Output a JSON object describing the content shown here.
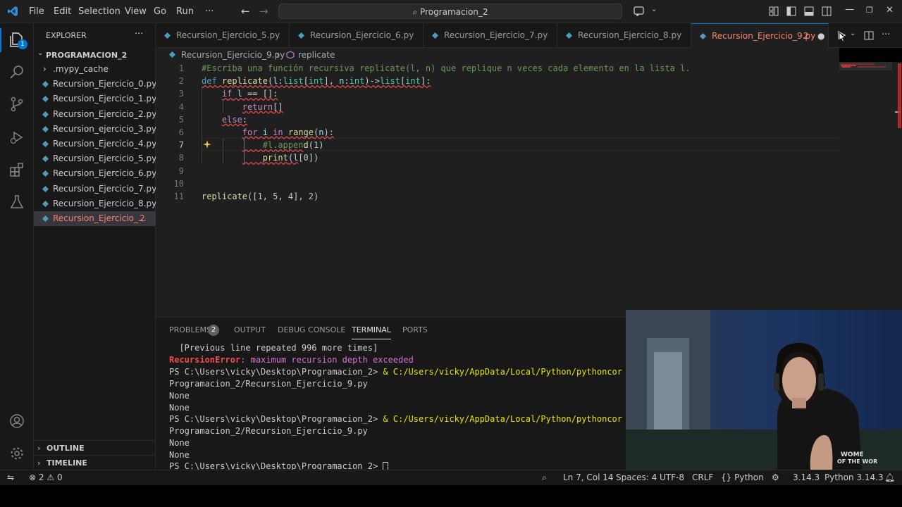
{
  "titlebar": {
    "menus": [
      "File",
      "Edit",
      "Selection",
      "View",
      "Go",
      "Run",
      "···"
    ],
    "search": "Programacion_2"
  },
  "activitybar": {
    "explorer_badge": "1"
  },
  "sidebar": {
    "title": "EXPLORER",
    "more": "···",
    "folder": "PROGRAMACION_2",
    "items": [
      {
        "label": ".mypy_cache",
        "type": "folder"
      },
      {
        "label": "Recursion_Ejercicio_0.py",
        "type": "py"
      },
      {
        "label": "Recursion_Ejercicio_1.py",
        "type": "py"
      },
      {
        "label": "Recursion_Ejercicio_2.py",
        "type": "py"
      },
      {
        "label": "Recursion_ejercicio_3.py",
        "type": "py"
      },
      {
        "label": "Recursion_Ejercicio_4.py",
        "type": "py"
      },
      {
        "label": "Recursion_Ejercicio_5.py",
        "type": "py"
      },
      {
        "label": "Recursion_Ejercicio_6.py",
        "type": "py"
      },
      {
        "label": "Recursion_Ejercicio_7.py",
        "type": "py"
      },
      {
        "label": "Recursion_Ejercicio_8.py",
        "type": "py"
      },
      {
        "label": "Recursion_Ejercicio_...",
        "type": "py",
        "badge": "2",
        "active": true
      }
    ],
    "outline": "OUTLINE",
    "timeline": "TIMELINE"
  },
  "tabs": [
    {
      "label": "Recursion_Ejercicio_5.py"
    },
    {
      "label": "Recursion_Ejercicio_6.py"
    },
    {
      "label": "Recursion_Ejercicio_7.py"
    },
    {
      "label": "Recursion_Ejercicio_8.py"
    },
    {
      "label": "Recursion_Ejercicio_9.py",
      "badge": "2",
      "dirty": "●",
      "active": true
    }
  ],
  "breadcrumb": {
    "file": "Recursion_Ejercicio_9.py",
    "separator": "›",
    "symbol": "replicate"
  },
  "editor": {
    "current_line": 7,
    "lines": [
      "#Escriba una función recursiva replicate(l, n) que replique n veces cada elemento en la lista l.",
      "def replicate(l:list[int], n:int)->list[int]:",
      "    if l == []:",
      "        return[]",
      "    else:",
      "        for i in range(n):",
      "            #l.append(1)",
      "            print(l[0])",
      "",
      "",
      "replicate([1, 5, 4], 2)"
    ]
  },
  "panel": {
    "tabs": [
      "PROBLEMS",
      "OUTPUT",
      "DEBUG CONSOLE",
      "TERMINAL",
      "PORTS"
    ],
    "problems_badge": "2",
    "active_tab": "TERMINAL",
    "terminal": {
      "l1": "  [Previous line repeated 996 more times]",
      "err_name": "RecursionError",
      "err_msg": ": maximum recursion depth exceeded",
      "prompt1": "PS C:\\Users\\vicky\\Desktop\\Programacion_2> ",
      "cmd_amp1": "& ",
      "cmd1": "C:/Users/vicky/AppData/Local/Python/pythoncor",
      "cont1": "Programacion_2/Recursion_Ejercicio_9.py",
      "out1": "None",
      "out2": "None",
      "prompt2": "PS C:\\Users\\vicky\\Desktop\\Programacion_2> ",
      "cmd_amp2": "& ",
      "cmd2": "C:/Users/vicky/AppData/Local/Python/pythoncor",
      "cont2": "Programacion_2/Recursion_Ejercicio_9.py",
      "out3": "None",
      "out4": "None",
      "prompt3": "PS C:\\Users\\vicky\\Desktop\\Programacion_2> "
    }
  },
  "webcam": {
    "shirt_text": "WOME\nOF THE WOR"
  },
  "statusbar": {
    "errors": "2",
    "warnings": "0",
    "position": "Ln 7, Col 14",
    "spaces": "Spaces: 4",
    "encoding": "UTF-8",
    "eol": "CRLF",
    "language": "Python",
    "interpreter_version": "3.14.3",
    "interpreter": "Python 3.14.3"
  },
  "colors": {
    "accent": "#0078d4",
    "error": "#f14c4c",
    "modified": "#f48771",
    "py_icon": "#519aba"
  }
}
